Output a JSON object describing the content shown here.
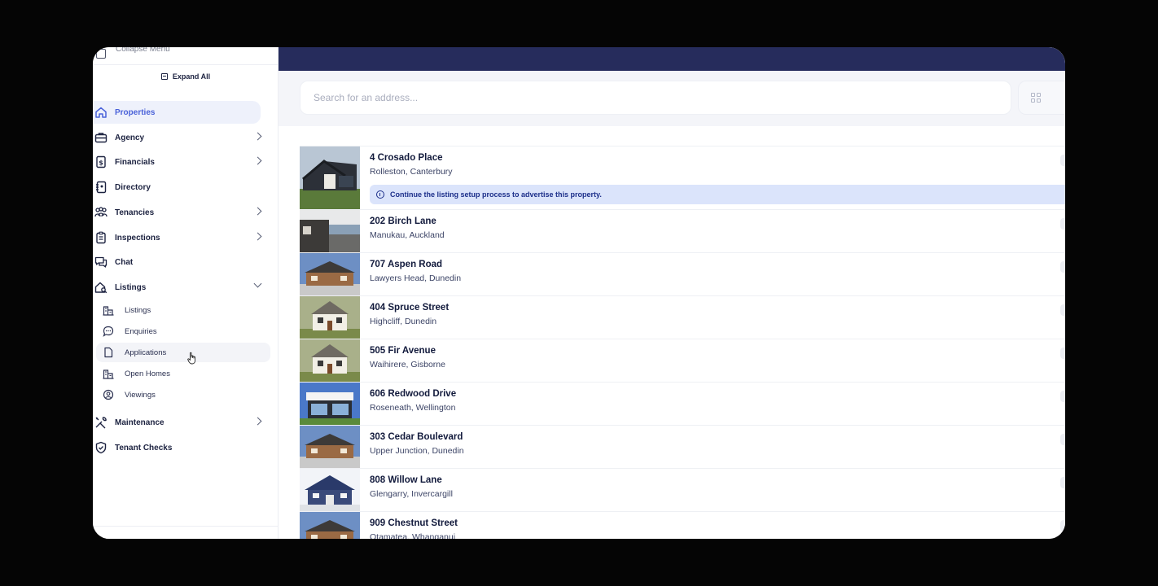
{
  "sidebar": {
    "collapse_label": "Collapse Menu",
    "expand_all_label": "Expand All",
    "items": [
      {
        "label": "Properties",
        "icon": "home-icon",
        "active": true
      },
      {
        "label": "Agency",
        "icon": "briefcase-icon"
      },
      {
        "label": "Financials",
        "icon": "dollar-document-icon"
      },
      {
        "label": "Directory",
        "icon": "address-book-icon"
      },
      {
        "label": "Tenancies",
        "icon": "people-icon"
      },
      {
        "label": "Inspections",
        "icon": "clipboard-icon"
      },
      {
        "label": "Chat",
        "icon": "chat-icon"
      },
      {
        "label": "Listings",
        "icon": "house-search-icon",
        "expanded": true
      },
      {
        "label": "Maintenance",
        "icon": "tools-icon"
      },
      {
        "label": "Tenant Checks",
        "icon": "shield-check-icon"
      }
    ],
    "listings_sub": [
      {
        "label": "Listings",
        "icon": "building-icon"
      },
      {
        "label": "Enquiries",
        "icon": "speech-bubble-icon"
      },
      {
        "label": "Applications",
        "icon": "document-icon"
      },
      {
        "label": "Open Homes",
        "icon": "building-icon"
      },
      {
        "label": "Viewings",
        "icon": "user-circle-icon"
      }
    ]
  },
  "search": {
    "placeholder": "Search for an address..."
  },
  "properties": [
    {
      "address": "4 Crosado Place",
      "suburb": "Rolleston, Canterbury",
      "notice": "Continue the listing setup process to advertise this property."
    },
    {
      "address": "202 Birch Lane",
      "suburb": "Manukau, Auckland"
    },
    {
      "address": "707 Aspen Road",
      "suburb": "Lawyers Head, Dunedin"
    },
    {
      "address": "404 Spruce Street",
      "suburb": "Highcliff, Dunedin"
    },
    {
      "address": "505 Fir Avenue",
      "suburb": "Waihirere, Gisborne"
    },
    {
      "address": "606 Redwood Drive",
      "suburb": "Roseneath, Wellington"
    },
    {
      "address": "303 Cedar Boulevard",
      "suburb": "Upper Junction, Dunedin"
    },
    {
      "address": "808 Willow Lane",
      "suburb": "Glengarry, Invercargill"
    },
    {
      "address": "909 Chestnut Street",
      "suburb": "Otamatea, Whanganui"
    }
  ],
  "colors": {
    "accent": "#4a62d9",
    "topbar": "#262c5c",
    "notice_bg": "#dbe4fb"
  }
}
